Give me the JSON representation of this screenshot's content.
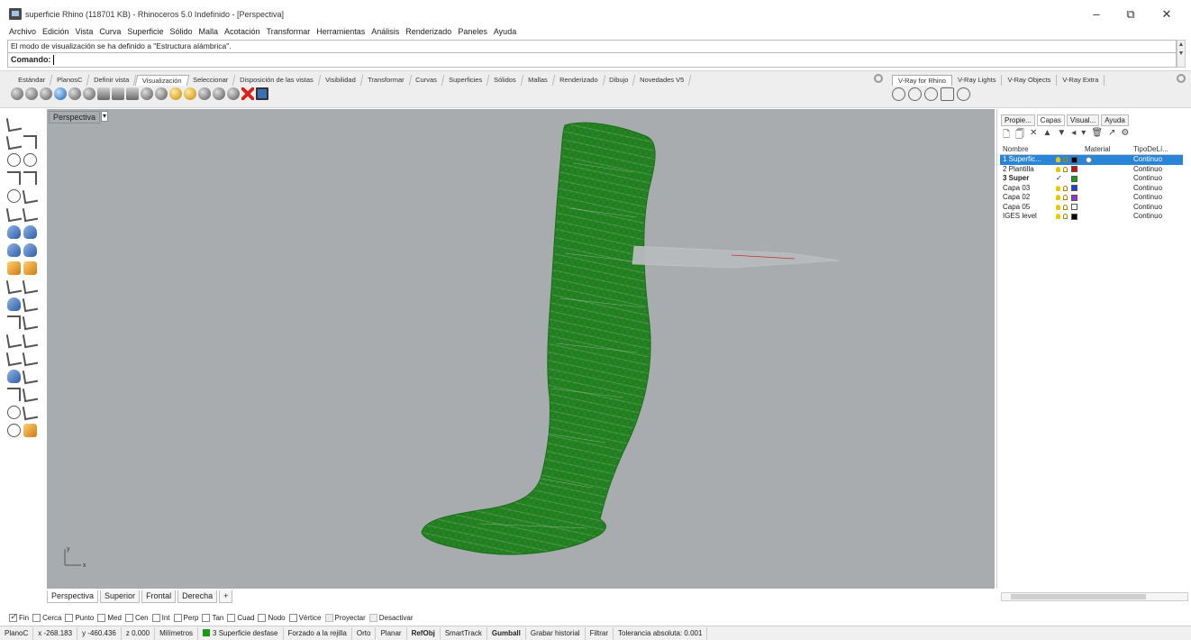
{
  "window": {
    "title": "superficie Rhino (118701 KB) - Rhinoceros 5.0 Indefinido - [Perspectiva]",
    "minimize": "–",
    "maximize": "⧉",
    "close": "✕"
  },
  "menu": [
    "Archivo",
    "Edición",
    "Vista",
    "Curva",
    "Superficie",
    "Sólido",
    "Malla",
    "Acotación",
    "Transformar",
    "Herramientas",
    "Análisis",
    "Renderizado",
    "Paneles",
    "Ayuda"
  ],
  "command": {
    "history": "El modo de visualización se ha definido a \"Estructura alámbrica\".",
    "prompt": "Comando:"
  },
  "toolbar_tabs": [
    "Estándar",
    "PlanosC",
    "Definir vista",
    "Visualización",
    "Seleccionar",
    "Disposición de las vistas",
    "Visibilidad",
    "Transformar",
    "Curvas",
    "Superficies",
    "Sólidos",
    "Mallas",
    "Renderizado",
    "Dibujo",
    "Novedades V5"
  ],
  "toolbar_active_tab": "Visualización",
  "vray_tabs": [
    "V-Ray for Rhino",
    "V-Ray Lights",
    "V-Ray Objects",
    "V-Ray Extra"
  ],
  "viewport": {
    "label": "Perspectiva",
    "menu_button": "▾",
    "axis_y": "y",
    "axis_x": "x"
  },
  "viewport_tabs": [
    "Perspectiva",
    "Superior",
    "Frontal",
    "Derecha",
    "+"
  ],
  "panel": {
    "tabs": [
      "Propie...",
      "Capas",
      "Visual...",
      "Ayuda"
    ],
    "active_tab": "Capas",
    "tools": [
      "🗋",
      "🗍",
      "✕",
      "▲",
      "▼",
      "◂",
      "▾",
      "🗑",
      "↗",
      "⚙"
    ],
    "headers": {
      "name": "Nombre",
      "material": "Material",
      "linetype": "TipoDeLí..."
    },
    "layers": [
      {
        "name": "1 Superfic...",
        "color": "#000000",
        "linetype": "Continuo",
        "selected": true,
        "current": false
      },
      {
        "name": "2 Plantilla",
        "color": "#d01010",
        "linetype": "Continuo",
        "selected": false,
        "current": false
      },
      {
        "name": "3 Super",
        "color": "#1a9a1a",
        "linetype": "Continuo",
        "selected": false,
        "current": true
      },
      {
        "name": "Capa 03",
        "color": "#1a40e0",
        "linetype": "Continuo",
        "selected": false,
        "current": false
      },
      {
        "name": "Capa 02",
        "color": "#9a30e0",
        "linetype": "Continuo",
        "selected": false,
        "current": false
      },
      {
        "name": "Capa 05",
        "color": "#ffffff",
        "linetype": "Continuo",
        "selected": false,
        "current": false
      },
      {
        "name": "IGES level",
        "color": "#000000",
        "linetype": "Continuo",
        "selected": false,
        "current": false
      }
    ]
  },
  "osnaps": [
    {
      "label": "Fin",
      "checked": true,
      "enabled": true
    },
    {
      "label": "Cerca",
      "checked": false,
      "enabled": true
    },
    {
      "label": "Punto",
      "checked": false,
      "enabled": true
    },
    {
      "label": "Med",
      "checked": false,
      "enabled": true
    },
    {
      "label": "Cen",
      "checked": false,
      "enabled": true
    },
    {
      "label": "Int",
      "checked": false,
      "enabled": true
    },
    {
      "label": "Perp",
      "checked": false,
      "enabled": true
    },
    {
      "label": "Tan",
      "checked": false,
      "enabled": true
    },
    {
      "label": "Cuad",
      "checked": false,
      "enabled": true
    },
    {
      "label": "Nodo",
      "checked": false,
      "enabled": true
    },
    {
      "label": "Vértice",
      "checked": false,
      "enabled": true
    },
    {
      "label": "Proyectar",
      "checked": false,
      "enabled": false
    },
    {
      "label": "Desactivar",
      "checked": false,
      "enabled": false
    }
  ],
  "status": {
    "cplane": "PlanoC",
    "x": "x -268.183",
    "y": "y -460.436",
    "z": "z 0.000",
    "units": "Milímetros",
    "layer": "3 Superficie desfase",
    "grid_snap": "Forzado a la rejilla",
    "ortho": "Orto",
    "planar": "Planar",
    "osnap": "RefObj",
    "smarttrack": "SmartTrack",
    "gumball": "Gumball",
    "history": "Grabar historial",
    "filter": "Filtrar",
    "tolerance": "Tolerancia absoluta: 0.001"
  },
  "colors": {
    "model_green": "#1e8a1e",
    "viewport_bg": "#a8acae",
    "selection_blue": "#2a84d8"
  }
}
